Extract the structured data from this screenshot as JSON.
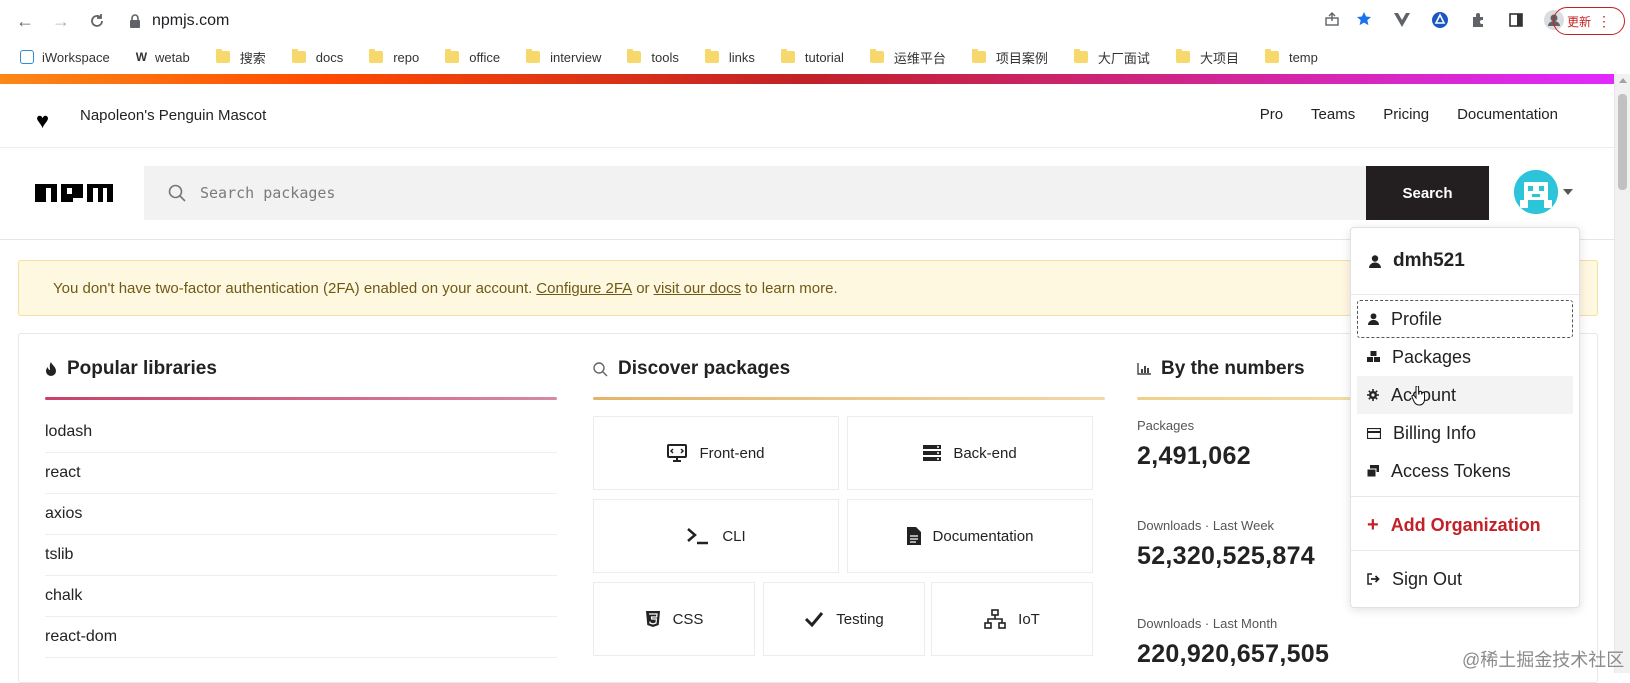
{
  "browser": {
    "url": "npmjs.com",
    "update_label": "更新",
    "bookmarks": [
      "iWorkspace",
      "wetab",
      "搜索",
      "docs",
      "repo",
      "office",
      "interview",
      "tools",
      "links",
      "tutorial",
      "运维平台",
      "项目案例",
      "大厂面试",
      "大项目",
      "temp"
    ]
  },
  "top_nav": {
    "tagline": "Napoleon's Penguin Mascot",
    "links": [
      "Pro",
      "Teams",
      "Pricing",
      "Documentation"
    ]
  },
  "search": {
    "placeholder": "Search packages",
    "button_label": "Search"
  },
  "banner": {
    "text_before": "You don't have two-factor authentication (2FA) enabled on your account.",
    "link1": "Configure 2FA",
    "middle": "or",
    "link2": "visit our docs",
    "text_after": "to learn more."
  },
  "popular": {
    "title": "Popular libraries",
    "items": [
      "lodash",
      "react",
      "axios",
      "tslib",
      "chalk",
      "react-dom"
    ]
  },
  "discover": {
    "title": "Discover packages",
    "tiles": [
      "Front-end",
      "Back-end",
      "CLI",
      "Documentation",
      "CSS",
      "Testing",
      "IoT"
    ]
  },
  "numbers": {
    "title": "By the numbers",
    "stats": [
      {
        "label": "Packages",
        "value": "2,491,062"
      },
      {
        "label": "Downloads · Last Week",
        "value": "52,320,525,874"
      },
      {
        "label": "Downloads · Last Month",
        "value": "220,920,657,505"
      }
    ]
  },
  "dropdown": {
    "username": "dmh521",
    "items": [
      "Profile",
      "Packages",
      "Account",
      "Billing Info",
      "Access Tokens"
    ],
    "add_org": "Add Organization",
    "sign_out": "Sign Out"
  },
  "watermark": "@稀土掘金技术社区",
  "colors": {
    "accent_red": "#c12127",
    "search_button": "#231f20",
    "banner_bg": "#fff8e0",
    "avatar": "#2bc4d9"
  }
}
